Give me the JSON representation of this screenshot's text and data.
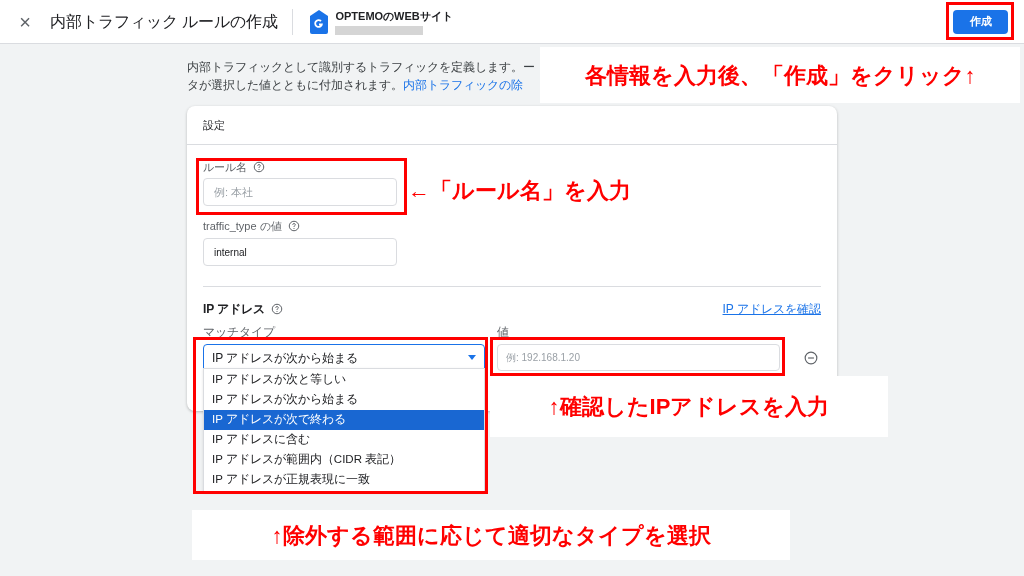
{
  "header": {
    "close": "×",
    "title": "内部トラフィック ルールの作成",
    "property": "OPTEMOのWEBサイト",
    "create_button": "作成"
  },
  "description": {
    "line_1": "内部トラフィックとして識別するトラフィックを定義します。ー",
    "line_2": "タが選択した値とともに付加されます。",
    "link": "内部トラフィックの除"
  },
  "card": {
    "title": "設定",
    "rule_name": {
      "label": "ルール名",
      "placeholder": "例: 本社"
    },
    "traffic_type": {
      "label": "traffic_type の値",
      "value": "internal"
    },
    "ip_section": {
      "title": "IP アドレス",
      "link": "IP アドレスを確認",
      "match_label": "マッチタイプ",
      "value_label": "値",
      "match_value": "IP アドレスが次から始まる",
      "value_placeholder": "例: 192.168.1.20"
    }
  },
  "dropdown_options": [
    {
      "label": "IP アドレスが次と等しい",
      "selected": false
    },
    {
      "label": "IP アドレスが次から始まる",
      "selected": false
    },
    {
      "label": "IP アドレスが次で終わる",
      "selected": true
    },
    {
      "label": "IP アドレスに含む",
      "selected": false
    },
    {
      "label": "IP アドレスが範囲内（CIDR 表記）",
      "selected": false
    },
    {
      "label": "IP アドレスが正規表現に一致",
      "selected": false
    }
  ],
  "annotations": [
    {
      "text": "各情報を入力後、「作成」をクリック↑"
    },
    {
      "text": "←「ルール名」を入力"
    },
    {
      "text": "↑確認したIPアドレスを入力"
    },
    {
      "text": "↑除外する範囲に応じて適切なタイプを選択"
    }
  ]
}
